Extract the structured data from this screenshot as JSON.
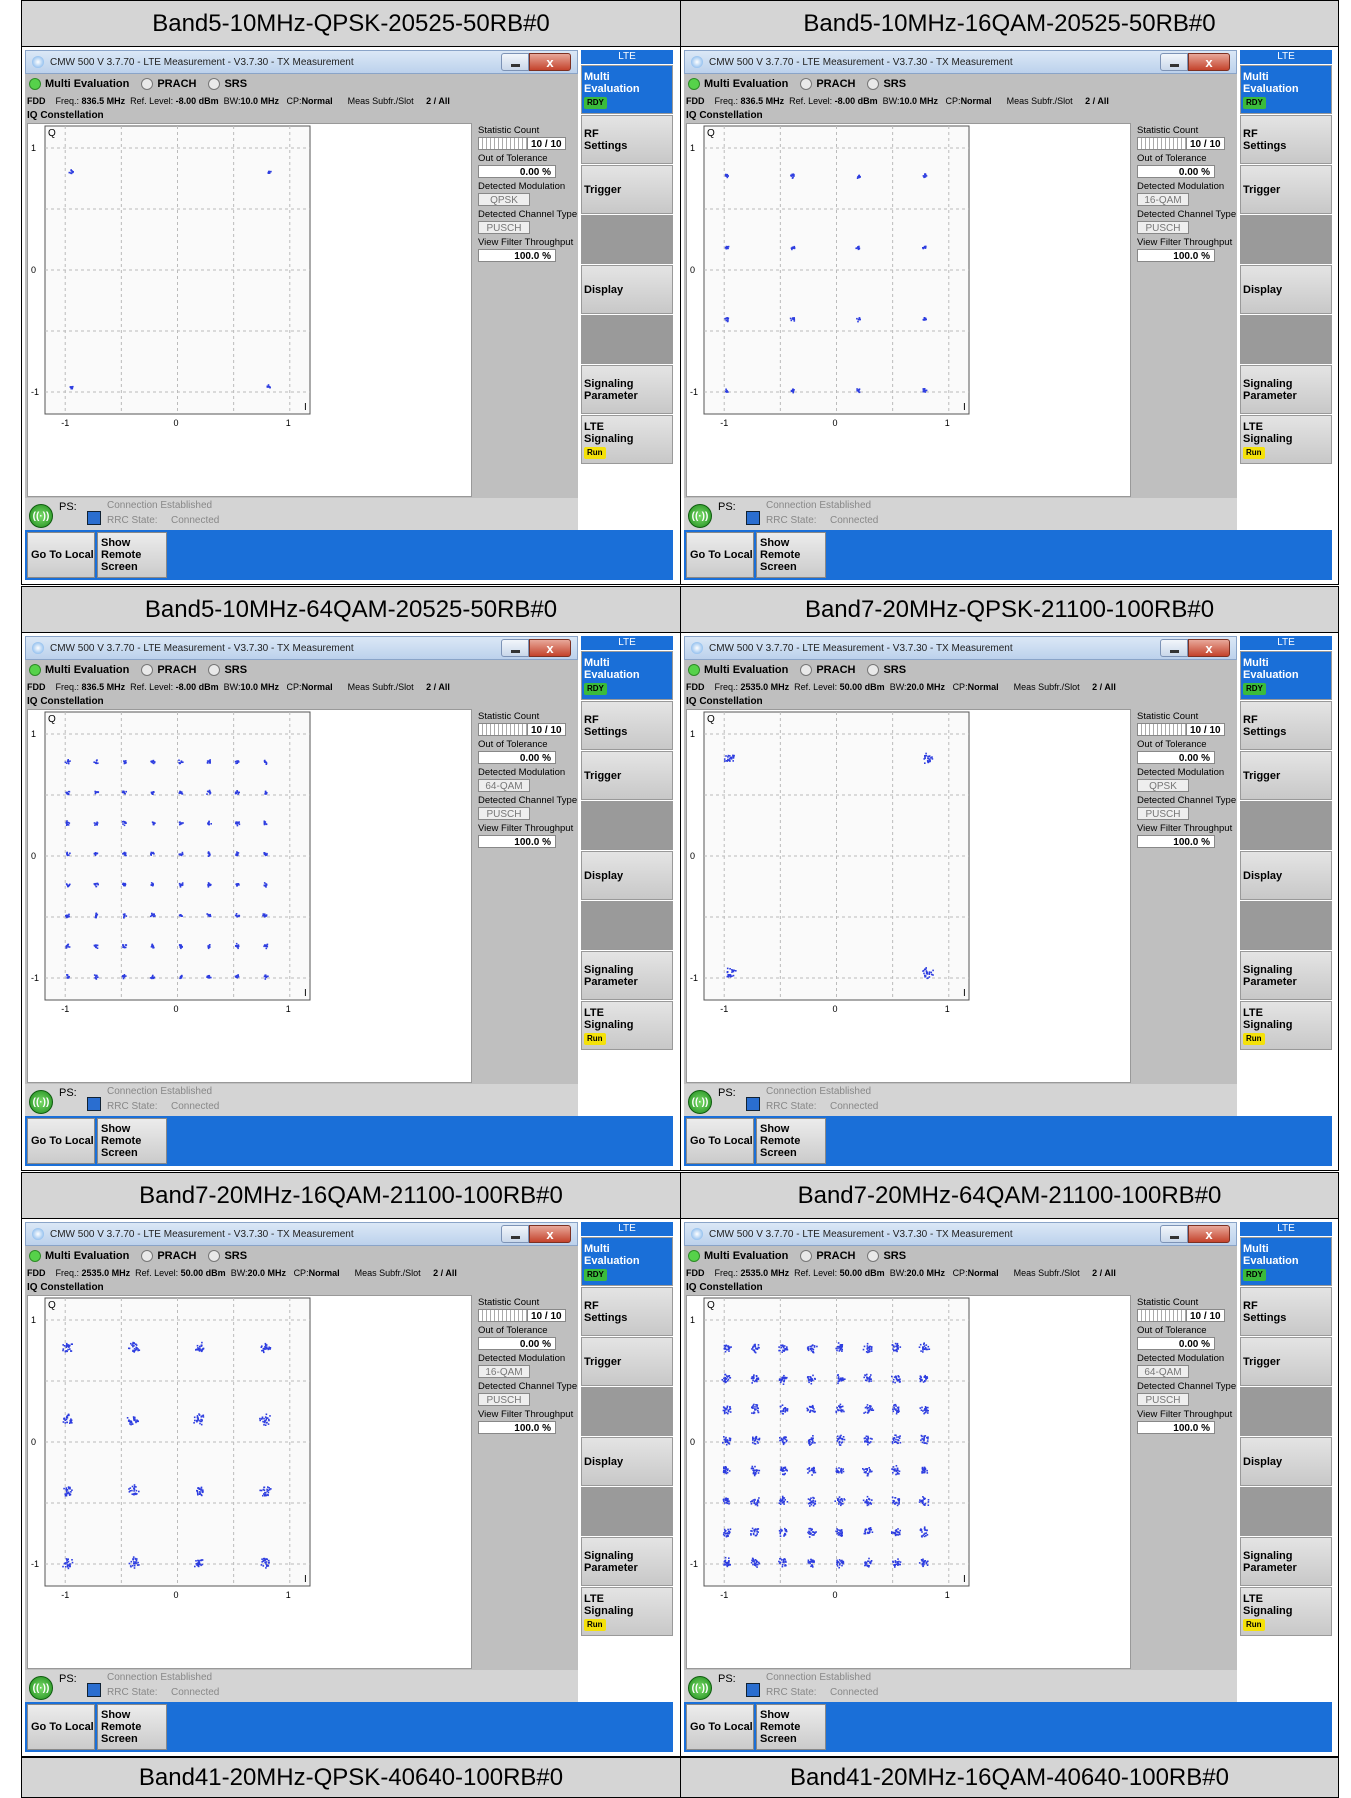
{
  "window": {
    "title": "CMW 500 V 3.7.70 - LTE Measurement - V3.7.30 - TX Measurement",
    "close_label": "x",
    "tabs": [
      "Multi Evaluation",
      "PRACH",
      "SRS"
    ],
    "section": "IQ Constellation",
    "params": {
      "mode": "FDD",
      "freq_label": "Freq.:",
      "ref_label": "Ref. Level:",
      "bw_label": "BW:",
      "cp_label": "CP:",
      "cp": "Normal",
      "meas_label": "Meas Subfr./Slot",
      "meas": "2  / All"
    },
    "stats": {
      "count_label": "Statistic Count",
      "count": "10 / 10",
      "oot_label": "Out of Tolerance",
      "oot": "0.00  %",
      "mod_label": "Detected Modulation",
      "chan_label": "Detected Channel Type",
      "chan": "PUSCH",
      "thr_label": "View Filter Throughput",
      "thr": "100.0  %"
    },
    "axes": {
      "q": "Q",
      "i": "I",
      "ticks_x": [
        "-1",
        "0",
        "1"
      ],
      "ticks_y": [
        "1",
        "0",
        "-1"
      ]
    },
    "status": {
      "ps": "PS:",
      "connection": "Connection Established",
      "rrc_label": "RRC State:",
      "rrc_value": "Connected"
    },
    "sidebar": {
      "top": "LTE",
      "multi": "Multi",
      "evaluation": "Evaluation",
      "rdy": "RDY",
      "rf": "RF",
      "settings": "Settings",
      "trigger": "Trigger",
      "display": "Display",
      "signaling": "Signaling",
      "parameter": "Parameter",
      "lte": "LTE",
      "lte_signaling": "Signaling",
      "run": "Run"
    },
    "footer": {
      "go_local": "Go To Local",
      "show_remote_1": "Show Remote",
      "show_remote_2": "Screen"
    }
  },
  "panels": [
    {
      "title": "Band5-10MHz-QPSK-20525-50RB#0",
      "freq": "836.5 MHz",
      "ref": "-8.00 dBm",
      "bw": "10.0 MHz",
      "modulation": "QPSK",
      "order": 4,
      "spread": 1
    },
    {
      "title": "Band5-10MHz-16QAM-20525-50RB#0",
      "freq": "836.5 MHz",
      "ref": "-8.00 dBm",
      "bw": "10.0 MHz",
      "modulation": "16-QAM",
      "order": 16,
      "spread": 1
    },
    {
      "title": "Band5-10MHz-64QAM-20525-50RB#0",
      "freq": "836.5 MHz",
      "ref": "-8.00 dBm",
      "bw": "10.0 MHz",
      "modulation": "64-QAM",
      "order": 64,
      "spread": 1
    },
    {
      "title": "Band7-20MHz-QPSK-21100-100RB#0",
      "freq": "2535.0 MHz",
      "ref": "50.00 dBm",
      "bw": "20.0 MHz",
      "modulation": "QPSK",
      "order": 4,
      "spread": 2.5
    },
    {
      "title": "Band7-20MHz-16QAM-21100-100RB#0",
      "freq": "2535.0 MHz",
      "ref": "50.00 dBm",
      "bw": "20.0 MHz",
      "modulation": "16-QAM",
      "order": 16,
      "spread": 2.5
    },
    {
      "title": "Band7-20MHz-64QAM-21100-100RB#0",
      "freq": "2535.0 MHz",
      "ref": "50.00 dBm",
      "bw": "20.0 MHz",
      "modulation": "64-QAM",
      "order": 64,
      "spread": 2.2
    }
  ],
  "footer_titles": [
    "Band41-20MHz-QPSK-40640-100RB#0",
    "Band41-20MHz-16QAM-40640-100RB#0"
  ]
}
